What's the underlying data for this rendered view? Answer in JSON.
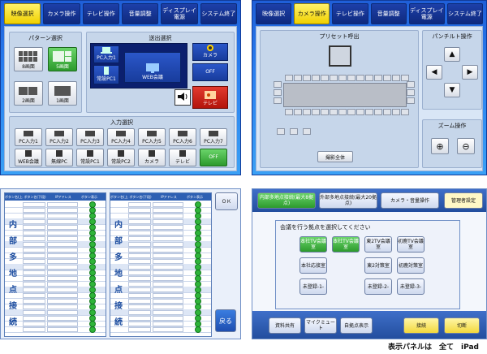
{
  "caption": "表示パネルは　全て　iPad",
  "panel_tl": {
    "tabs": [
      "映像選択",
      "カメラ操作",
      "テレビ操作",
      "音量調整",
      "ディスプレイ電源",
      "システム終了"
    ],
    "active_tab": 0,
    "pattern": {
      "title": "パターン選択",
      "items": [
        "8画面",
        "5画面",
        "2画面",
        "1画面"
      ]
    },
    "output": {
      "title": "送出選択",
      "items": [
        "PC入力1",
        "WEB会議",
        "常設PC1",
        "カメラ",
        "OFF",
        "テレビ"
      ]
    },
    "input": {
      "title": "入力選択",
      "row1": [
        "PC入力1",
        "PC入力2",
        "PC入力3",
        "PC入力4",
        "PC入力5",
        "PC入力6",
        "PC入力7"
      ],
      "row2": [
        "WEB会議",
        "無線PC",
        "常設PC1",
        "常設PC2",
        "カメラ",
        "テレビ",
        "OFF"
      ]
    }
  },
  "panel_tr": {
    "tabs": [
      "映像選択",
      "カメラ操作",
      "テレビ操作",
      "音量調整",
      "ディスプレイ電源",
      "システム終了"
    ],
    "active_tab": 1,
    "preset_title": "プリセット呼出",
    "preset_all": "撮影全体",
    "pt_title": "パンチルト操作",
    "zoom_title": "ズーム操作",
    "arrows": [
      "▲",
      "◀",
      "▶",
      "▼"
    ],
    "zoom": [
      "⊕",
      "⊖"
    ]
  },
  "panel_bl": {
    "header": [
      "ボタン名(上段)",
      "ボタン名(下段)",
      "IPアドレス",
      "ボタン表示"
    ],
    "side_chars": [
      "内",
      "部",
      "多",
      "地",
      "点",
      "接",
      "続"
    ],
    "side_chars2": [
      "内",
      "部",
      "多",
      "地",
      "点",
      "接",
      "続"
    ],
    "back": "戻る",
    "corner": "ＯＫ"
  },
  "panel_br": {
    "tabs": [
      "内部多地点接続(最大8拠点)",
      "外部多地点接続(最大20拠点)",
      "カメラ・音量操作",
      "管理者設定"
    ],
    "prompt": "会議を行う拠点を選択してください",
    "grid": [
      [
        "本社TV会議室",
        "本社TV会議室",
        "東2TV会議室",
        "初鹿TV会議室"
      ],
      [
        "本社応接室",
        "",
        "東2対策室",
        "初鹿対策室"
      ],
      [
        "未登録-1-",
        "",
        "未登録-2-",
        "未登録-3-"
      ]
    ],
    "bottom": [
      "資料共有",
      "マイクミュート",
      "自拠点表示",
      "接続",
      "切断"
    ]
  }
}
